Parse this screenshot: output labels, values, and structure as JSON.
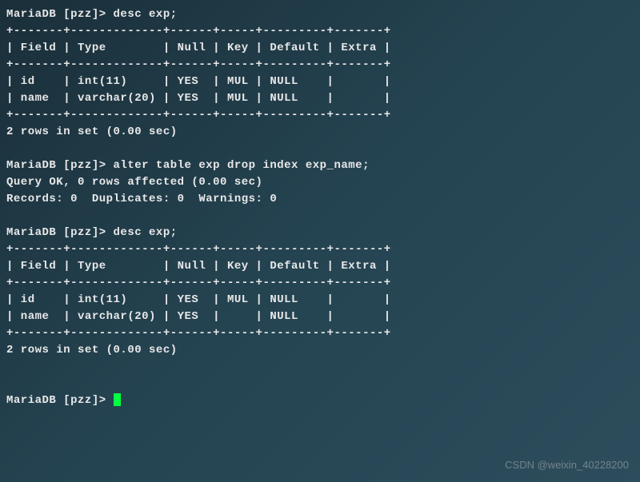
{
  "prompt1": "MariaDB [pzz]> desc exp;",
  "border1": "+-------+-------------+------+-----+---------+-------+",
  "header1": "| Field | Type        | Null | Key | Default | Extra |",
  "border2": "+-------+-------------+------+-----+---------+-------+",
  "row1": "| id    | int(11)     | YES  | MUL | NULL    |       |",
  "row2": "| name  | varchar(20) | YES  | MUL | NULL    |       |",
  "border3": "+-------+-------------+------+-----+---------+-------+",
  "result1": "2 rows in set (0.00 sec)",
  "prompt2": "MariaDB [pzz]> alter table exp drop index exp_name;",
  "result2": "Query OK, 0 rows affected (0.00 sec)",
  "result3": "Records: 0  Duplicates: 0  Warnings: 0",
  "prompt3": "MariaDB [pzz]> desc exp;",
  "border4": "+-------+-------------+------+-----+---------+-------+",
  "header2": "| Field | Type        | Null | Key | Default | Extra |",
  "border5": "+-------+-------------+------+-----+---------+-------+",
  "row3": "| id    | int(11)     | YES  | MUL | NULL    |       |",
  "row4": "| name  | varchar(20) | YES  |     | NULL    |       |",
  "border6": "+-------+-------------+------+-----+---------+-------+",
  "result4": "2 rows in set (0.00 sec)",
  "prompt4": "MariaDB [pzz]> ",
  "watermark": "CSDN @weixin_40228200"
}
